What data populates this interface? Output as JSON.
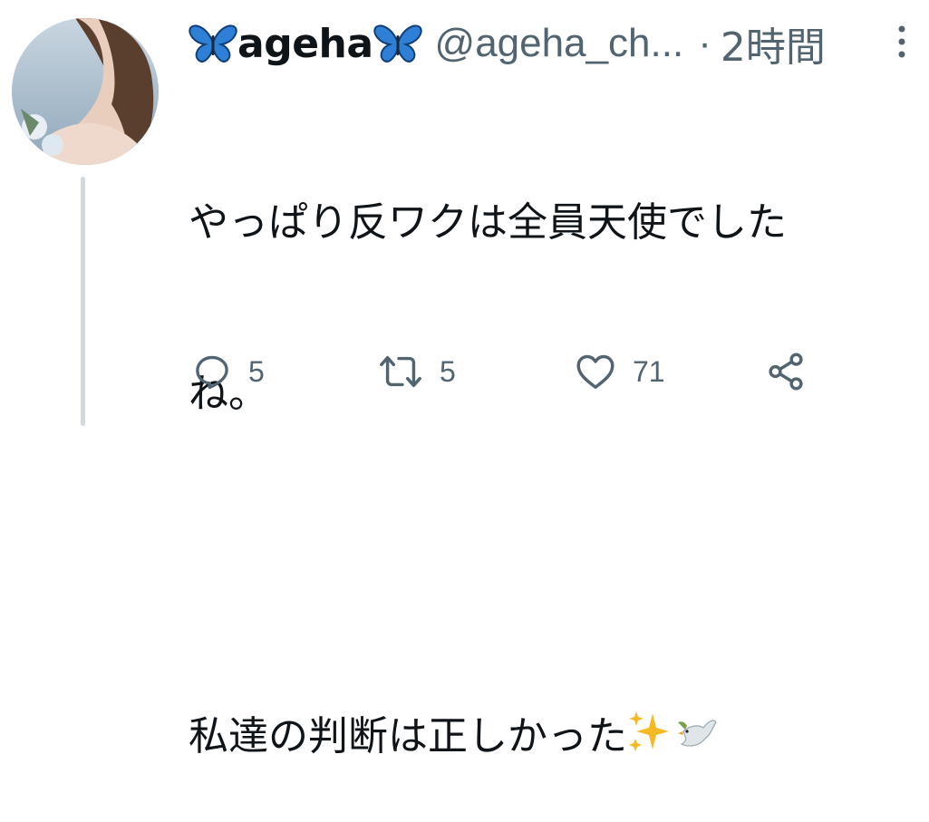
{
  "tweet": {
    "display_name": "ageha",
    "handle": "@ageha_ch...",
    "dot": "·",
    "time": "2時間",
    "text_line1": "やっぱり反ワクは全員天使でした",
    "text_line2": "ね。",
    "text_line3": "私達の判断は正しかった",
    "emojis": [
      "sparkles-emoji",
      "dove-emoji"
    ],
    "name_emoji": "butterfly-emoji"
  },
  "actions": {
    "reply_count": "5",
    "retweet_count": "5",
    "like_count": "71"
  },
  "colors": {
    "text": "#0f1419",
    "secondary": "#536471",
    "thread_line": "#cfd9de",
    "butterfly": "#2f7fd6"
  }
}
